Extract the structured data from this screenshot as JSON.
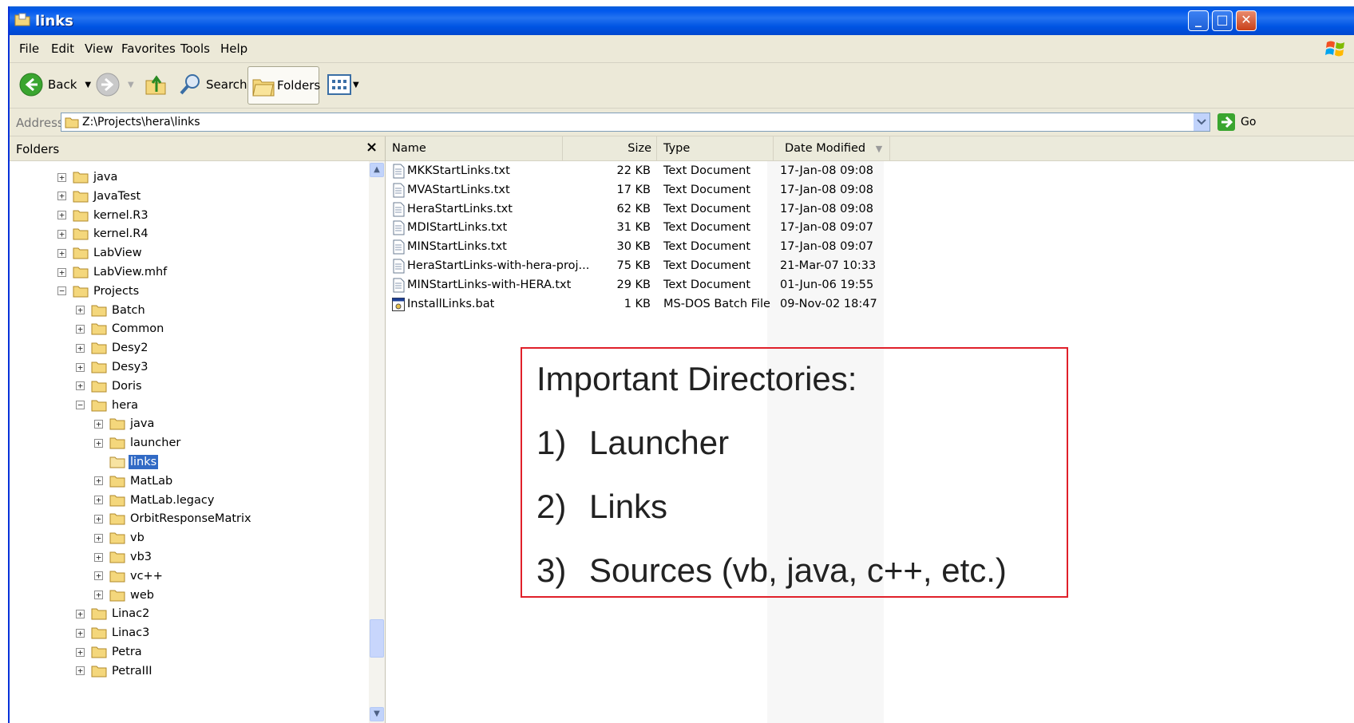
{
  "window": {
    "title": "links"
  },
  "menu": [
    "File",
    "Edit",
    "View",
    "Favorites",
    "Tools",
    "Help"
  ],
  "toolbar": {
    "back_label": "Back",
    "search_label": "Search",
    "folders_label": "Folders"
  },
  "address": {
    "label": "Address",
    "value": "Z:\\Projects\\hera\\links",
    "go_label": "Go"
  },
  "folders_pane": {
    "title": "Folders",
    "close_glyph": "×",
    "tree": [
      {
        "label": "java",
        "depth": 0,
        "expander": "+"
      },
      {
        "label": "JavaTest",
        "depth": 0,
        "expander": "+"
      },
      {
        "label": "kernel.R3",
        "depth": 0,
        "expander": "+"
      },
      {
        "label": "kernel.R4",
        "depth": 0,
        "expander": "+"
      },
      {
        "label": "LabView",
        "depth": 0,
        "expander": "+"
      },
      {
        "label": "LabView.mhf",
        "depth": 0,
        "expander": "+"
      },
      {
        "label": "Projects",
        "depth": 0,
        "expander": "−"
      },
      {
        "label": "Batch",
        "depth": 1,
        "expander": "+"
      },
      {
        "label": "Common",
        "depth": 1,
        "expander": "+"
      },
      {
        "label": "Desy2",
        "depth": 1,
        "expander": "+"
      },
      {
        "label": "Desy3",
        "depth": 1,
        "expander": "+"
      },
      {
        "label": "Doris",
        "depth": 1,
        "expander": "+"
      },
      {
        "label": "hera",
        "depth": 1,
        "expander": "−"
      },
      {
        "label": "java",
        "depth": 2,
        "expander": "+"
      },
      {
        "label": "launcher",
        "depth": 2,
        "expander": "+"
      },
      {
        "label": "links",
        "depth": 2,
        "expander": "",
        "selected": true
      },
      {
        "label": "MatLab",
        "depth": 2,
        "expander": "+"
      },
      {
        "label": "MatLab.legacy",
        "depth": 2,
        "expander": "+"
      },
      {
        "label": "OrbitResponseMatrix",
        "depth": 2,
        "expander": "+"
      },
      {
        "label": "vb",
        "depth": 2,
        "expander": "+"
      },
      {
        "label": "vb3",
        "depth": 2,
        "expander": "+"
      },
      {
        "label": "vc++",
        "depth": 2,
        "expander": "+"
      },
      {
        "label": "web",
        "depth": 2,
        "expander": "+"
      },
      {
        "label": "Linac2",
        "depth": 1,
        "expander": "+"
      },
      {
        "label": "Linac3",
        "depth": 1,
        "expander": "+"
      },
      {
        "label": "Petra",
        "depth": 1,
        "expander": "+"
      },
      {
        "label": "PetraIII",
        "depth": 1,
        "expander": "+"
      }
    ]
  },
  "file_list": {
    "columns": {
      "name": "Name",
      "size": "Size",
      "type": "Type",
      "date": "Date Modified"
    },
    "files": [
      {
        "name": "MKKStartLinks.txt",
        "size": "22 KB",
        "type": "Text Document",
        "date": "17-Jan-08 09:08",
        "icon": "text-file-icon"
      },
      {
        "name": "MVAStartLinks.txt",
        "size": "17 KB",
        "type": "Text Document",
        "date": "17-Jan-08 09:08",
        "icon": "text-file-icon"
      },
      {
        "name": "HeraStartLinks.txt",
        "size": "62 KB",
        "type": "Text Document",
        "date": "17-Jan-08 09:08",
        "icon": "text-file-icon"
      },
      {
        "name": "MDIStartLinks.txt",
        "size": "31 KB",
        "type": "Text Document",
        "date": "17-Jan-08 09:07",
        "icon": "text-file-icon"
      },
      {
        "name": "MINStartLinks.txt",
        "size": "30 KB",
        "type": "Text Document",
        "date": "17-Jan-08 09:07",
        "icon": "text-file-icon"
      },
      {
        "name": "HeraStartLinks-with-hera-proj...",
        "size": "75 KB",
        "type": "Text Document",
        "date": "21-Mar-07 10:33",
        "icon": "text-file-icon"
      },
      {
        "name": "MINStartLinks-with-HERA.txt",
        "size": "29 KB",
        "type": "Text Document",
        "date": "01-Jun-06 19:55",
        "icon": "text-file-icon"
      },
      {
        "name": "InstallLinks.bat",
        "size": "1 KB",
        "type": "MS-DOS Batch File",
        "date": "09-Nov-02 18:47",
        "icon": "batch-file-icon"
      }
    ]
  },
  "annotation": {
    "heading": "Important Directories:",
    "items": [
      {
        "num": "1)",
        "text": "Launcher"
      },
      {
        "num": "2)",
        "text": "Links"
      },
      {
        "num": "3)",
        "text": "Sources (vb, java, c++, etc.)"
      }
    ]
  },
  "colors": {
    "titlebar": "#0054e3",
    "chrome": "#ece9d8",
    "selection": "#316ac5",
    "annotation_border": "#e0202a"
  }
}
